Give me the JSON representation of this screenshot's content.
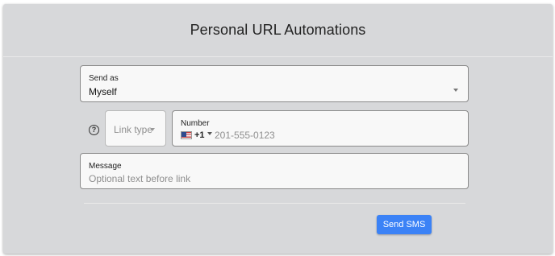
{
  "title": "Personal URL Automations",
  "send_as": {
    "label": "Send as",
    "value": "Myself",
    "icon": "chevron-down-icon"
  },
  "help": {
    "icon": "help-circle-icon",
    "glyph": "?"
  },
  "link_type": {
    "placeholder": "Link type",
    "icon": "chevron-down-icon"
  },
  "number": {
    "label": "Number",
    "country_flag": "us-flag-icon",
    "dial_code": "+1",
    "placeholder": "201-555-0123"
  },
  "message": {
    "label": "Message",
    "placeholder": "Optional text before link"
  },
  "actions": {
    "send_label": "Send SMS"
  },
  "colors": {
    "card_background": "#d7d8da",
    "field_background": "#f8f8f8",
    "primary_button": "#3b82f6"
  }
}
